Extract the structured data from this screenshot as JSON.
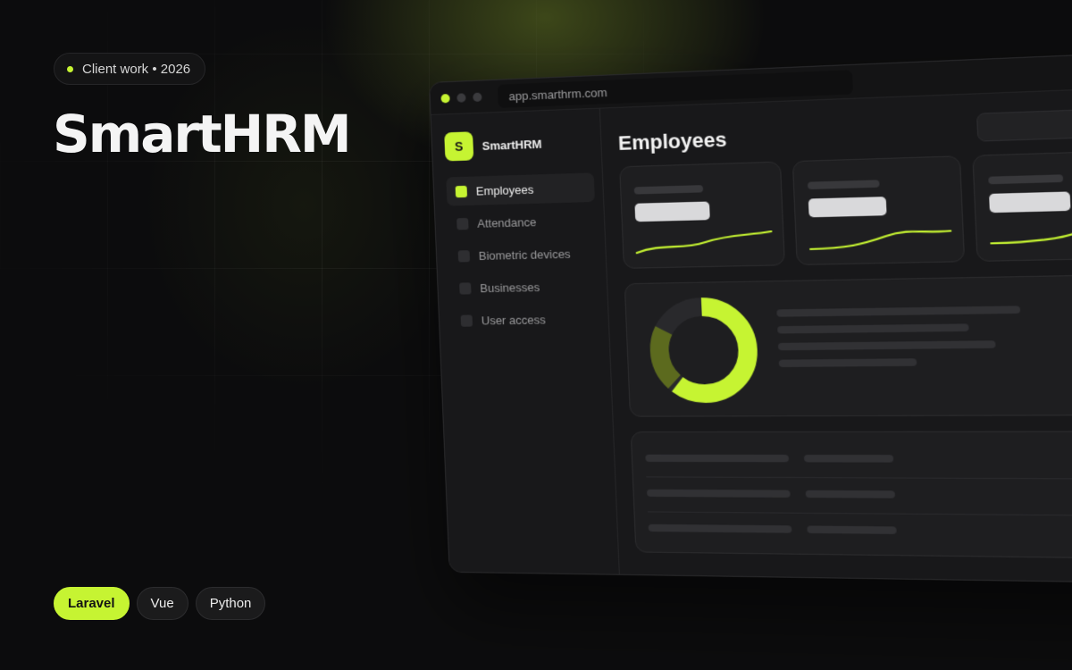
{
  "eyebrow": {
    "text": "Client work • 2026",
    "dot_color": "#c6f432"
  },
  "hero": {
    "title": "SmartHRM"
  },
  "tags": [
    "Laravel",
    "Vue",
    "Python"
  ],
  "accent_color": "#c6f432",
  "window": {
    "url": "app.smarthrm.com",
    "brand": {
      "initial": "S",
      "name": "SmartHRM"
    },
    "nav": [
      {
        "label": "Employees",
        "active": true
      },
      {
        "label": "Attendance",
        "active": false
      },
      {
        "label": "Biometric devices",
        "active": false
      },
      {
        "label": "Businesses",
        "active": false
      },
      {
        "label": "User access",
        "active": false
      }
    ],
    "page_title": "Employees",
    "donut": {
      "primary_fraction": 0.62,
      "secondary_fraction": 0.22,
      "primary_color": "#c6f432",
      "secondary_color": "#5c6a1e"
    },
    "status_pill_colors": [
      "#47521e",
      "#3a3a3d",
      "#47521e"
    ]
  }
}
